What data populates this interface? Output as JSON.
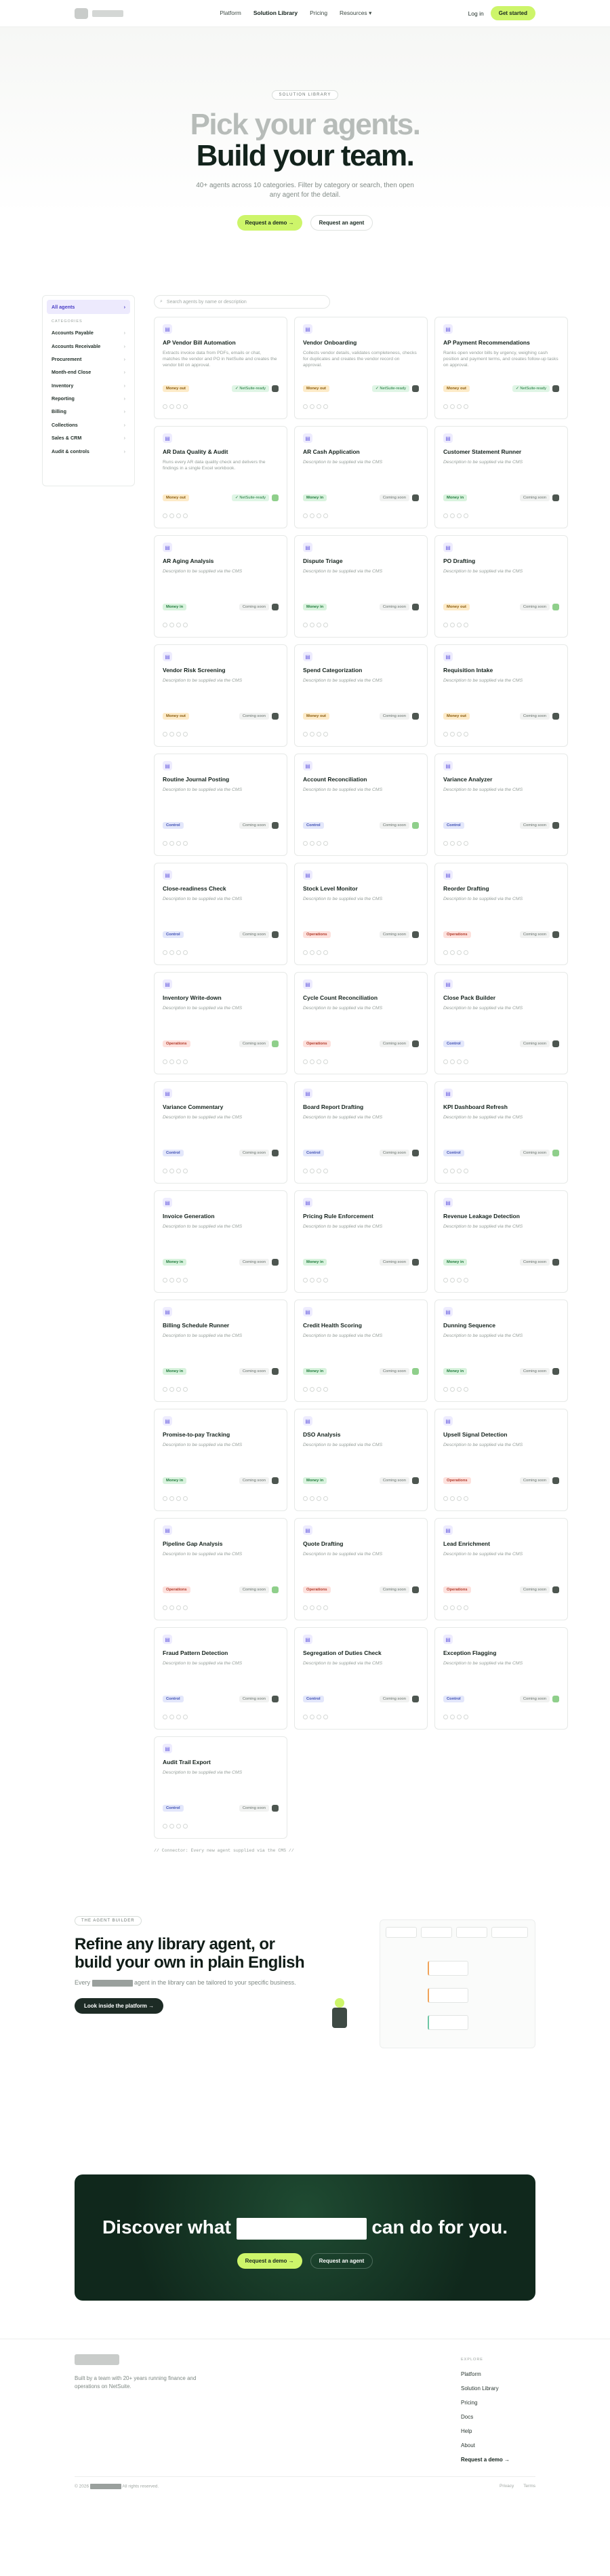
{
  "nav": {
    "links": [
      "Platform",
      "Solution Library",
      "Pricing",
      "Resources"
    ],
    "login": "Log in",
    "cta": "Get started"
  },
  "hero": {
    "eyebrow": "SOLUTION LIBRARY",
    "title_light": "Pick your agents.",
    "title_dark": "Build your team.",
    "subtitle": "40+ agents across 10 categories. Filter by category or search, then open any agent for the detail.",
    "demo": "Request a demo →",
    "agent": "Request an agent"
  },
  "sidebar": {
    "all": "All agents",
    "heading": "CATEGORIES",
    "items": [
      "Accounts Payable",
      "Accounts Receivable",
      "Procurement",
      "Month-end Close",
      "Inventory",
      "Reporting",
      "Billing",
      "Collections",
      "Sales & CRM",
      "Audit & controls"
    ]
  },
  "search": {
    "placeholder": "Search agents by name or description"
  },
  "cards": [
    {
      "title": "AP Vendor Bill Automation",
      "desc": "Extracts invoice data from PDFs, emails or chat, matches the vendor and PO in NetSuite and creates the vendor bill on approval.",
      "tag": "Money out",
      "tagc": "pay",
      "status": "✓ NetSuite-ready",
      "st": "ready"
    },
    {
      "title": "Vendor Onboarding",
      "desc": "Collects vendor details, validates completeness, checks for duplicates and creates the vendor record on approval.",
      "tag": "Money out",
      "tagc": "pay",
      "status": "✓ NetSuite-ready",
      "st": "ready"
    },
    {
      "title": "AP Payment Recommendations",
      "desc": "Ranks open vendor bills by urgency, weighing cash position and payment terms, and creates follow-up tasks on approval.",
      "tag": "Money out",
      "tagc": "pay",
      "status": "✓ NetSuite-ready",
      "st": "ready"
    },
    {
      "title": "AR Data Quality & Audit",
      "desc": "Runs every AR data quality check and delivers the findings in a single Excel workbook.",
      "tag": "Money out",
      "tagc": "pay",
      "status": "✓ NetSuite-ready",
      "st": "ready"
    },
    {
      "title": "AR Cash Application",
      "desc": "Description to be supplied via the CMS",
      "tag": "Money in",
      "tagc": "cash",
      "status": "Coming soon",
      "st": "soon"
    },
    {
      "title": "Customer Statement Runner",
      "desc": "Description to be supplied via the CMS",
      "tag": "Money in",
      "tagc": "cash",
      "status": "Coming soon",
      "st": "soon"
    },
    {
      "title": "AR Aging Analysis",
      "desc": "Description to be supplied via the CMS",
      "tag": "Money in",
      "tagc": "cash",
      "status": "Coming soon",
      "st": "soon"
    },
    {
      "title": "Dispute Triage",
      "desc": "Description to be supplied via the CMS",
      "tag": "Money in",
      "tagc": "cash",
      "status": "Coming soon",
      "st": "soon"
    },
    {
      "title": "PO Drafting",
      "desc": "Description to be supplied via the CMS",
      "tag": "Money out",
      "tagc": "pay",
      "status": "Coming soon",
      "st": "soon"
    },
    {
      "title": "Vendor Risk Screening",
      "desc": "Description to be supplied via the CMS",
      "tag": "Money out",
      "tagc": "pay",
      "status": "Coming soon",
      "st": "soon"
    },
    {
      "title": "Spend Categorization",
      "desc": "Description to be supplied via the CMS",
      "tag": "Money out",
      "tagc": "pay",
      "status": "Coming soon",
      "st": "soon"
    },
    {
      "title": "Requisition Intake",
      "desc": "Description to be supplied via the CMS",
      "tag": "Money out",
      "tagc": "pay",
      "status": "Coming soon",
      "st": "soon"
    },
    {
      "title": "Routine Journal Posting",
      "desc": "Description to be supplied via the CMS",
      "tag": "Control",
      "tagc": "close",
      "status": "Coming soon",
      "st": "soon"
    },
    {
      "title": "Account Reconciliation",
      "desc": "Description to be supplied via the CMS",
      "tag": "Control",
      "tagc": "close",
      "status": "Coming soon",
      "st": "soon"
    },
    {
      "title": "Variance Analyzer",
      "desc": "Description to be supplied via the CMS",
      "tag": "Control",
      "tagc": "close",
      "status": "Coming soon",
      "st": "soon"
    },
    {
      "title": "Close-readiness Check",
      "desc": "Description to be supplied via the CMS",
      "tag": "Control",
      "tagc": "close",
      "status": "Coming soon",
      "st": "soon"
    },
    {
      "title": "Stock Level Monitor",
      "desc": "Description to be supplied via the CMS",
      "tag": "Operations",
      "tagc": "ops",
      "status": "Coming soon",
      "st": "soon"
    },
    {
      "title": "Reorder Drafting",
      "desc": "Description to be supplied via the CMS",
      "tag": "Operations",
      "tagc": "ops",
      "status": "Coming soon",
      "st": "soon"
    },
    {
      "title": "Inventory Write-down",
      "desc": "Description to be supplied via the CMS",
      "tag": "Operations",
      "tagc": "ops",
      "status": "Coming soon",
      "st": "soon"
    },
    {
      "title": "Cycle Count Reconciliation",
      "desc": "Description to be supplied via the CMS",
      "tag": "Operations",
      "tagc": "ops",
      "status": "Coming soon",
      "st": "soon"
    },
    {
      "title": "Close Pack Builder",
      "desc": "Description to be supplied via the CMS",
      "tag": "Control",
      "tagc": "close",
      "status": "Coming soon",
      "st": "soon"
    },
    {
      "title": "Variance Commentary",
      "desc": "Description to be supplied via the CMS",
      "tag": "Control",
      "tagc": "close",
      "status": "Coming soon",
      "st": "soon"
    },
    {
      "title": "Board Report Drafting",
      "desc": "Description to be supplied via the CMS",
      "tag": "Control",
      "tagc": "close",
      "status": "Coming soon",
      "st": "soon"
    },
    {
      "title": "KPI Dashboard Refresh",
      "desc": "Description to be supplied via the CMS",
      "tag": "Control",
      "tagc": "close",
      "status": "Coming soon",
      "st": "soon"
    },
    {
      "title": "Invoice Generation",
      "desc": "Description to be supplied via the CMS",
      "tag": "Money in",
      "tagc": "cash",
      "status": "Coming soon",
      "st": "soon"
    },
    {
      "title": "Pricing Rule Enforcement",
      "desc": "Description to be supplied via the CMS",
      "tag": "Money in",
      "tagc": "cash",
      "status": "Coming soon",
      "st": "soon"
    },
    {
      "title": "Revenue Leakage Detection",
      "desc": "Description to be supplied via the CMS",
      "tag": "Money in",
      "tagc": "cash",
      "status": "Coming soon",
      "st": "soon"
    },
    {
      "title": "Billing Schedule Runner",
      "desc": "Description to be supplied via the CMS",
      "tag": "Money in",
      "tagc": "cash",
      "status": "Coming soon",
      "st": "soon"
    },
    {
      "title": "Credit Health Scoring",
      "desc": "Description to be supplied via the CMS",
      "tag": "Money in",
      "tagc": "cash",
      "status": "Coming soon",
      "st": "soon"
    },
    {
      "title": "Dunning Sequence",
      "desc": "Description to be supplied via the CMS",
      "tag": "Money in",
      "tagc": "cash",
      "status": "Coming soon",
      "st": "soon"
    },
    {
      "title": "Promise-to-pay Tracking",
      "desc": "Description to be supplied via the CMS",
      "tag": "Money in",
      "tagc": "cash",
      "status": "Coming soon",
      "st": "soon"
    },
    {
      "title": "DSO Analysis",
      "desc": "Description to be supplied via the CMS",
      "tag": "Money in",
      "tagc": "cash",
      "status": "Coming soon",
      "st": "soon"
    },
    {
      "title": "Upsell Signal Detection",
      "desc": "Description to be supplied via the CMS",
      "tag": "Operations",
      "tagc": "ops",
      "status": "Coming soon",
      "st": "soon"
    },
    {
      "title": "Pipeline Gap Analysis",
      "desc": "Description to be supplied via the CMS",
      "tag": "Operations",
      "tagc": "ops",
      "status": "Coming soon",
      "st": "soon"
    },
    {
      "title": "Quote Drafting",
      "desc": "Description to be supplied via the CMS",
      "tag": "Operations",
      "tagc": "ops",
      "status": "Coming soon",
      "st": "soon"
    },
    {
      "title": "Lead Enrichment",
      "desc": "Description to be supplied via the CMS",
      "tag": "Operations",
      "tagc": "ops",
      "status": "Coming soon",
      "st": "soon"
    },
    {
      "title": "Fraud Pattern Detection",
      "desc": "Description to be supplied via the CMS",
      "tag": "Control",
      "tagc": "close",
      "status": "Coming soon",
      "st": "soon"
    },
    {
      "title": "Segregation of Duties Check",
      "desc": "Description to be supplied via the CMS",
      "tag": "Control",
      "tagc": "close",
      "status": "Coming soon",
      "st": "soon"
    },
    {
      "title": "Exception Flagging",
      "desc": "Description to be supplied via the CMS",
      "tag": "Control",
      "tagc": "close",
      "status": "Coming soon",
      "st": "soon"
    },
    {
      "title": "Audit Trail Export",
      "desc": "Description to be supplied via the CMS",
      "tag": "Control",
      "tagc": "close",
      "status": "Coming soon",
      "st": "soon"
    }
  ],
  "grid_note": "// Connector: Every new agent supplied via the CMS //",
  "builder": {
    "eyebrow": "THE AGENT BUILDER",
    "title": "Refine any library agent, or build your own in plain English",
    "text_a": "Every",
    "text_b": "agent in the library can be tailored to your specific business.",
    "cta": "Look inside the platform →"
  },
  "band": {
    "before": "Discover what",
    "after": "can do for you.",
    "demo": "Request a demo →",
    "agent": "Request an agent"
  },
  "footer": {
    "tagline": "Built by a team with 20+ years running finance and operations on NetSuite.",
    "heading": "EXPLORE",
    "links": [
      "Platform",
      "Solution Library",
      "Pricing",
      "Docs",
      "Help",
      "About"
    ],
    "demo": "Request a demo →",
    "copyright": "© 2026",
    "rights": "All rights reserved.",
    "legal": [
      "Privacy",
      "Terms"
    ]
  }
}
